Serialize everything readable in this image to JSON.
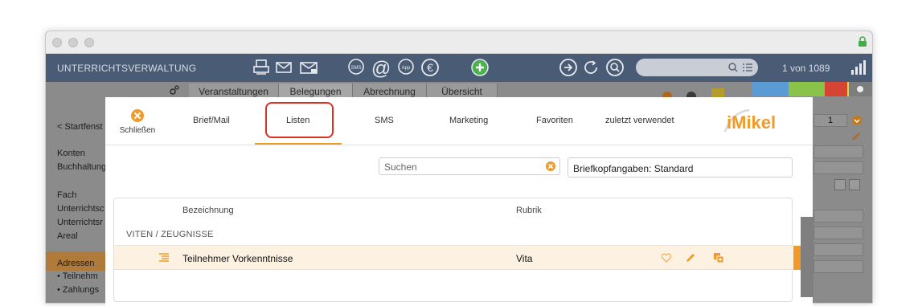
{
  "app": {
    "title": "UNTERRICHTSVERWALTUNG",
    "record_count": "1 von 1089",
    "toolbar_icons": [
      "printer-icon",
      "envelope-icon",
      "letter-icon",
      "sms-icon",
      "at-icon",
      "app-icon",
      "euro-icon",
      "add-icon",
      "forward-icon",
      "refresh-icon",
      "search-icon",
      "list-icon",
      "bar-chart-icon"
    ]
  },
  "background": {
    "tabs": [
      "Veranstaltungen",
      "Belegungen",
      "Abrechnung",
      "Übersicht"
    ],
    "left_items": [
      "< Startfenst",
      "Konten",
      "Buchhaltung",
      "Fach",
      "Unterrichtsc",
      "Unterrichtsr",
      "Areal",
      "Adressen",
      "• Teilnehm",
      "• Zahlungs"
    ],
    "page_field_value": "1",
    "colors": [
      "#5b9bd5",
      "#8bc34a",
      "#f2d22e",
      "#d64533"
    ]
  },
  "modal": {
    "close_label": "Schließen",
    "tabs": [
      "Brief/Mail",
      "Listen",
      "SMS",
      "Marketing",
      "Favoriten",
      "zuletzt verwendet"
    ],
    "active_tab": "Listen",
    "logo_text": "iMikel",
    "search_placeholder": "Suchen",
    "letterhead": "Briefkopfangaben: Standard",
    "table": {
      "columns": [
        "Bezeichnung",
        "Rubrik"
      ],
      "group": "VITEN / ZEUGNISSE",
      "rows": [
        {
          "name": "Teilnehmer Vorkenntnisse",
          "category": "Vita"
        }
      ]
    },
    "accent_color": "#f09a2b",
    "highlight_color": "#d9311f"
  }
}
